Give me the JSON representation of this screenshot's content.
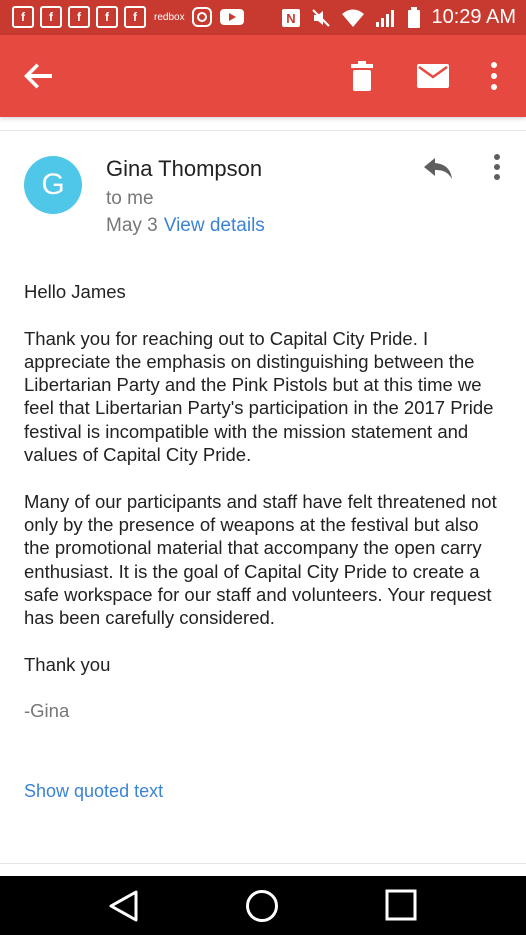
{
  "status_bar": {
    "time": "10:29 AM",
    "left_icon_names": [
      "facebook-icon",
      "facebook-icon",
      "facebook-icon",
      "facebook-icon",
      "facebook-icon",
      "redbox-icon",
      "instagram-icon",
      "youtube-icon"
    ],
    "redbox_text": "redbox",
    "right_icon_names": [
      "nfc-icon",
      "mute-icon",
      "wifi-icon",
      "signal-icon",
      "battery-icon"
    ],
    "colors": {
      "bar": "#c83a2f"
    }
  },
  "toolbar": {
    "icons": [
      "back-arrow-icon",
      "trash-icon",
      "mail-icon",
      "more-vert-icon"
    ],
    "color": "#e5493f"
  },
  "email": {
    "avatar_letter": "G",
    "avatar_color": "#4ec7e8",
    "sender": "Gina Thompson",
    "recipient": "to me",
    "date": "May 3",
    "view_details": "View details",
    "greeting": "Hello James",
    "paragraph1": "Thank you for reaching out to Capital City Pride.  I appreciate the emphasis on distinguishing between the Libertarian Party and the Pink Pistols but at this time we feel that Libertarian Party's participation in the 2017 Pride festival is incompatible with the mission statement and values of Capital City Pride.",
    "paragraph2": "Many of our participants and staff have felt threatened not only by the presence of weapons at the festival but also the promotional material that accompany the open carry enthusiast.  It is the goal of Capital City Pride to create a safe workspace for our staff and volunteers.  Your request has been carefully considered.",
    "closing": "Thank you",
    "signature": "-Gina",
    "show_quoted": "Show quoted text"
  },
  "nav_bar": {
    "icons": [
      "back-triangle-icon",
      "home-circle-icon",
      "recents-square-icon"
    ]
  }
}
